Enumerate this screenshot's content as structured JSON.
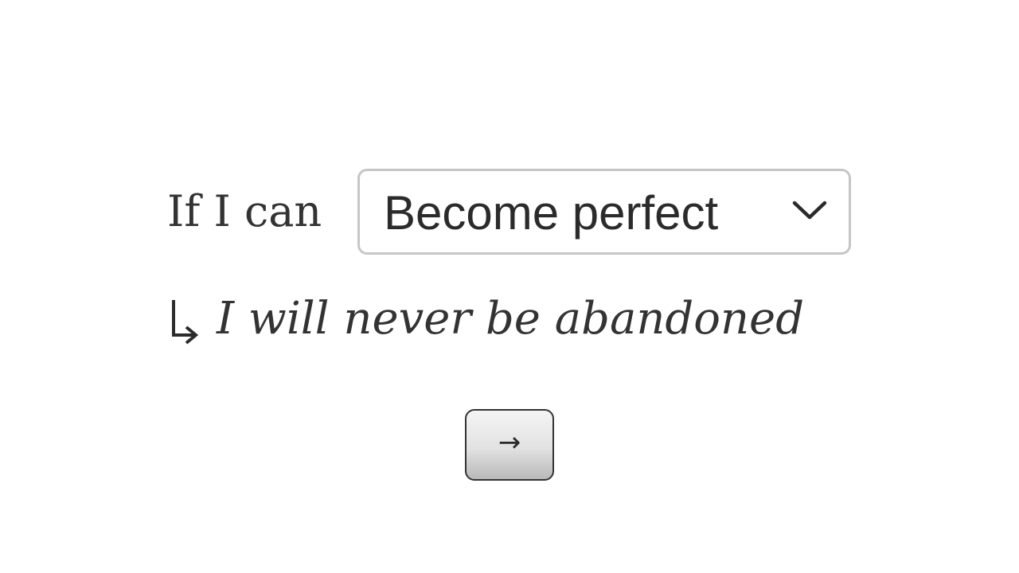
{
  "prompt": {
    "label": "If I can"
  },
  "dropdown": {
    "selected_value": "Become perfect",
    "icon": "chevron-down-icon"
  },
  "result": {
    "arrow_icon": "return-arrow-icon",
    "text": "I will never be abandoned"
  },
  "next_button": {
    "label": "→",
    "icon": "right-arrow-icon"
  },
  "colors": {
    "text": "#333333",
    "border": "#c6c6c6",
    "background": "#ffffff"
  }
}
